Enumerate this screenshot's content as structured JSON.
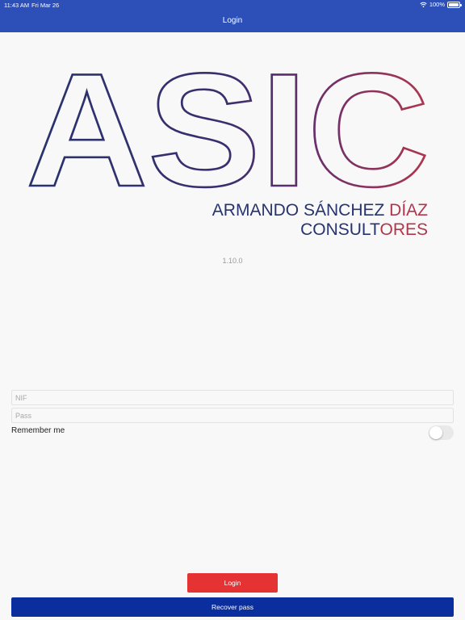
{
  "status_bar": {
    "time": "11:43 AM",
    "date": "Fri Mar 26",
    "battery": "100%",
    "icons": [
      "wifi-icon",
      "battery-icon"
    ]
  },
  "nav": {
    "title": "Login"
  },
  "logo": {
    "letters": [
      "A",
      "S",
      "I",
      "C"
    ],
    "name_part1": "ARMANDO SÁNCHEZ ",
    "name_part2": "DÍAZ",
    "subtitle_part1": "CONSULT",
    "subtitle_part2": "ORES",
    "colors": {
      "navy": "#27336e",
      "purple": "#6a2f6c",
      "crimson": "#b0364c"
    }
  },
  "version": "1.10.0",
  "form": {
    "nif": {
      "placeholder": "NIF",
      "value": ""
    },
    "pass": {
      "placeholder": "Pass",
      "value": ""
    },
    "remember_label": "Remember me",
    "remember_on": false
  },
  "buttons": {
    "login": "Login",
    "recover": "Recover pass"
  },
  "colors": {
    "header": "#2d4fb8",
    "login_button": "#e53232",
    "recover_button": "#0b2e9e"
  }
}
